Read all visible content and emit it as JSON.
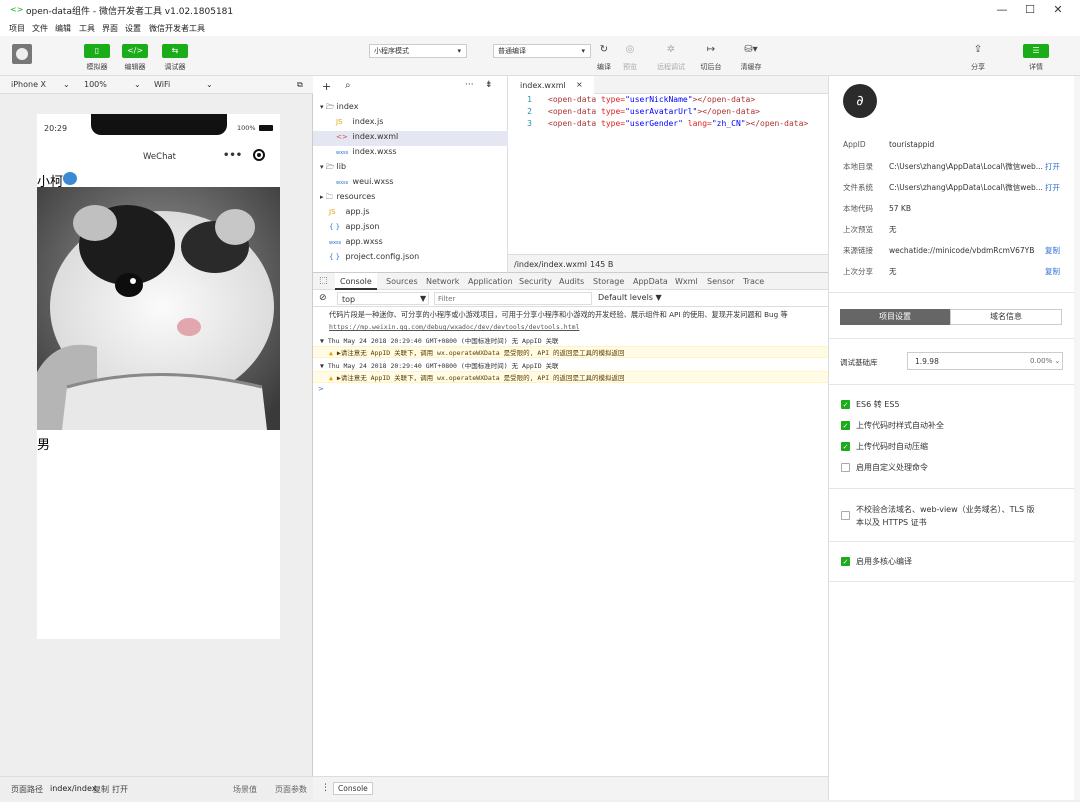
{
  "window": {
    "title": "open-data组件 - 微信开发者工具 v1.02.1805181",
    "minimize": "—",
    "maximize": "☐",
    "close": "✕"
  },
  "menu": [
    "项目",
    "文件",
    "编辑",
    "工具",
    "界面",
    "设置",
    "微信开发者工具"
  ],
  "toolbar": {
    "simulator": "模拟器",
    "editor": "编辑器",
    "debugger": "调试器",
    "mode": "小程序模式",
    "compile_mode": "普通编译",
    "compile": "编译",
    "preview": "预览",
    "remote_debug": "远程调试",
    "background": "切后台",
    "clear_cache": "清缓存",
    "share": "分享",
    "details": "详情"
  },
  "device": {
    "model": "iPhone X",
    "zoom": "100%",
    "network": "WiFi"
  },
  "phone": {
    "time": "20:29",
    "battery": "100%",
    "title": "WeChat",
    "nickname": "小柯",
    "gender": "男"
  },
  "filetree": {
    "items": [
      {
        "name": "index",
        "icon": "▾ 🗁"
      },
      {
        "name": "index.js",
        "icon": "JS"
      },
      {
        "name": "index.wxml",
        "icon": "<>"
      },
      {
        "name": "index.wxss",
        "icon": "wxss"
      },
      {
        "name": "lib",
        "icon": "▾ 🗁"
      },
      {
        "name": "weui.wxss",
        "icon": "wxss"
      },
      {
        "name": "resources",
        "icon": "▸ 🗀"
      },
      {
        "name": "app.js",
        "icon": "JS"
      },
      {
        "name": "app.json",
        "icon": "{ }"
      },
      {
        "name": "app.wxss",
        "icon": "wxss"
      },
      {
        "name": "project.config.json",
        "icon": "{ }"
      }
    ]
  },
  "editor": {
    "tab": "index.wxml",
    "lines": [
      {
        "n": "1",
        "type": "userNickName",
        "lang": ""
      },
      {
        "n": "2",
        "type": "userAvatarUrl",
        "lang": ""
      },
      {
        "n": "3",
        "type": "userGender",
        "lang": "zh_CN"
      }
    ],
    "path": "/index/index.wxml",
    "size": "145 B"
  },
  "console": {
    "tabs": [
      "Console",
      "Sources",
      "Network",
      "Application",
      "Security",
      "Audits",
      "Storage",
      "AppData",
      "Wxml",
      "Sensor",
      "Trace"
    ],
    "context": "top",
    "filter_placeholder": "Filter",
    "levels": "Default levels ▼",
    "intro": "代码片段是一种迷你、可分享的小程序或小游戏项目，可用于分享小程序和小游戏的开发经验、展示组件和 API 的使用、复现开发问题和 Bug 等",
    "link": "https://mp.weixin.qq.com/debug/wxadoc/dev/devtools/devtools.html",
    "log1": "Thu May 24 2018 20:29:40 GMT+0800 (中国标准时间) 无 AppID 关联",
    "warn1": "▶请注意无 AppID 关联下，调用 wx.operateWXData 是受限的, API 的返回是工具的模拟返回",
    "log2": "Thu May 24 2018 20:29:40 GMT+0800 (中国标准时间) 无 AppID 关联",
    "warn2": "▶请注意无 AppID 关联下，调用 wx.operateWXData 是受限的, API 的返回是工具的模拟返回",
    "prompt": ">",
    "drawer_tab": "Console"
  },
  "details": {
    "appid_label": "AppID",
    "appid": "touristappid",
    "dir_label": "本地目录",
    "dir": "C:\\Users\\zhang\\AppData\\Local\\微信web...",
    "open1": "打开",
    "fs_label": "文件系统",
    "fs": "C:\\Users\\zhang\\AppData\\Local\\微信web...",
    "open2": "打开",
    "code_label": "本地代码",
    "code": "57 KB",
    "preview_label": "上次预览",
    "preview": "无",
    "source_label": "来源链接",
    "source": "wechatide://minicode/vbdmRcmV67YB",
    "copy1": "复制",
    "share_label": "上次分享",
    "share": "无",
    "copy2": "复制",
    "tab1": "项目设置",
    "tab2": "域名信息",
    "lib_label": "调试基础库",
    "lib_version": "1.9.98",
    "lib_pct": "0.00% ⌄",
    "opts": [
      {
        "label": "ES6 转 ES5",
        "on": true
      },
      {
        "label": "上传代码时样式自动补全",
        "on": true
      },
      {
        "label": "上传代码时自动压缩",
        "on": true
      },
      {
        "label": "启用自定义处理命令",
        "on": false
      }
    ],
    "nocheck1": "不校验合法域名、web-view（业务域名）、TLS 版",
    "nocheck2": "本以及 HTTPS 证书",
    "multicore": "启用多核心编译"
  },
  "status": {
    "path_label": "页面路径",
    "path": "index/index",
    "copy": "复制",
    "open": "打开",
    "scene": "场景值",
    "params": "页面参数"
  }
}
